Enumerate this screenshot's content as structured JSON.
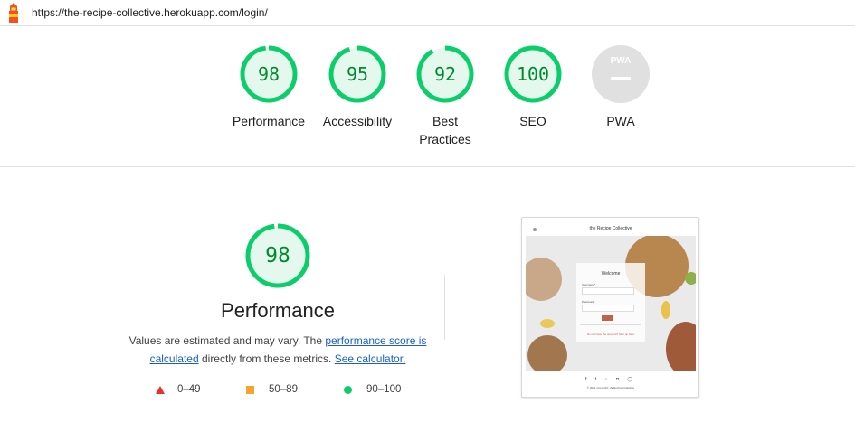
{
  "header": {
    "url": "https://the-recipe-collective.herokuapp.com/login/"
  },
  "summary": {
    "gauges": [
      {
        "label": "Performance",
        "score": "98",
        "fraction": 0.98
      },
      {
        "label": "Accessibility",
        "score": "95",
        "fraction": 0.95
      },
      {
        "label_line1": "Best",
        "label_line2": "Practices",
        "score": "92",
        "fraction": 0.92
      },
      {
        "label": "SEO",
        "score": "100",
        "fraction": 1.0
      },
      {
        "label": "PWA",
        "badge_text": "PWA"
      }
    ]
  },
  "category": {
    "score": "98",
    "fraction": 0.98,
    "title": "Performance",
    "desc_prefix": "Values are estimated and may vary. The ",
    "desc_link1": "performance score is calculated",
    "desc_middle": " directly from these metrics. ",
    "desc_link2": "See calculator.",
    "legend": [
      {
        "shape": "triangle",
        "range": "0–49",
        "color": "#eb2e30"
      },
      {
        "shape": "square",
        "range": "50–89",
        "color": "#f5a42f"
      },
      {
        "shape": "circle",
        "range": "90–100",
        "color": "#0bce6b"
      }
    ]
  },
  "screenshot": {
    "site_title": "the Recipe Collective",
    "card_title": "Welcome",
    "username_label": "Username*",
    "password_label": "Password*",
    "link_text": "Do not have the account? Sign up here",
    "footer_icons": "f t ⌂ ◘ ◯",
    "footer_copy": "© 2021 Copyright: theRecipe Collective"
  },
  "colors": {
    "pass": "#0bce6b",
    "pass_text": "#008a2c",
    "pass_fill": "#e5f8ee",
    "pwa_gray": "#e0e0e0",
    "link": "#1a5fcb"
  }
}
